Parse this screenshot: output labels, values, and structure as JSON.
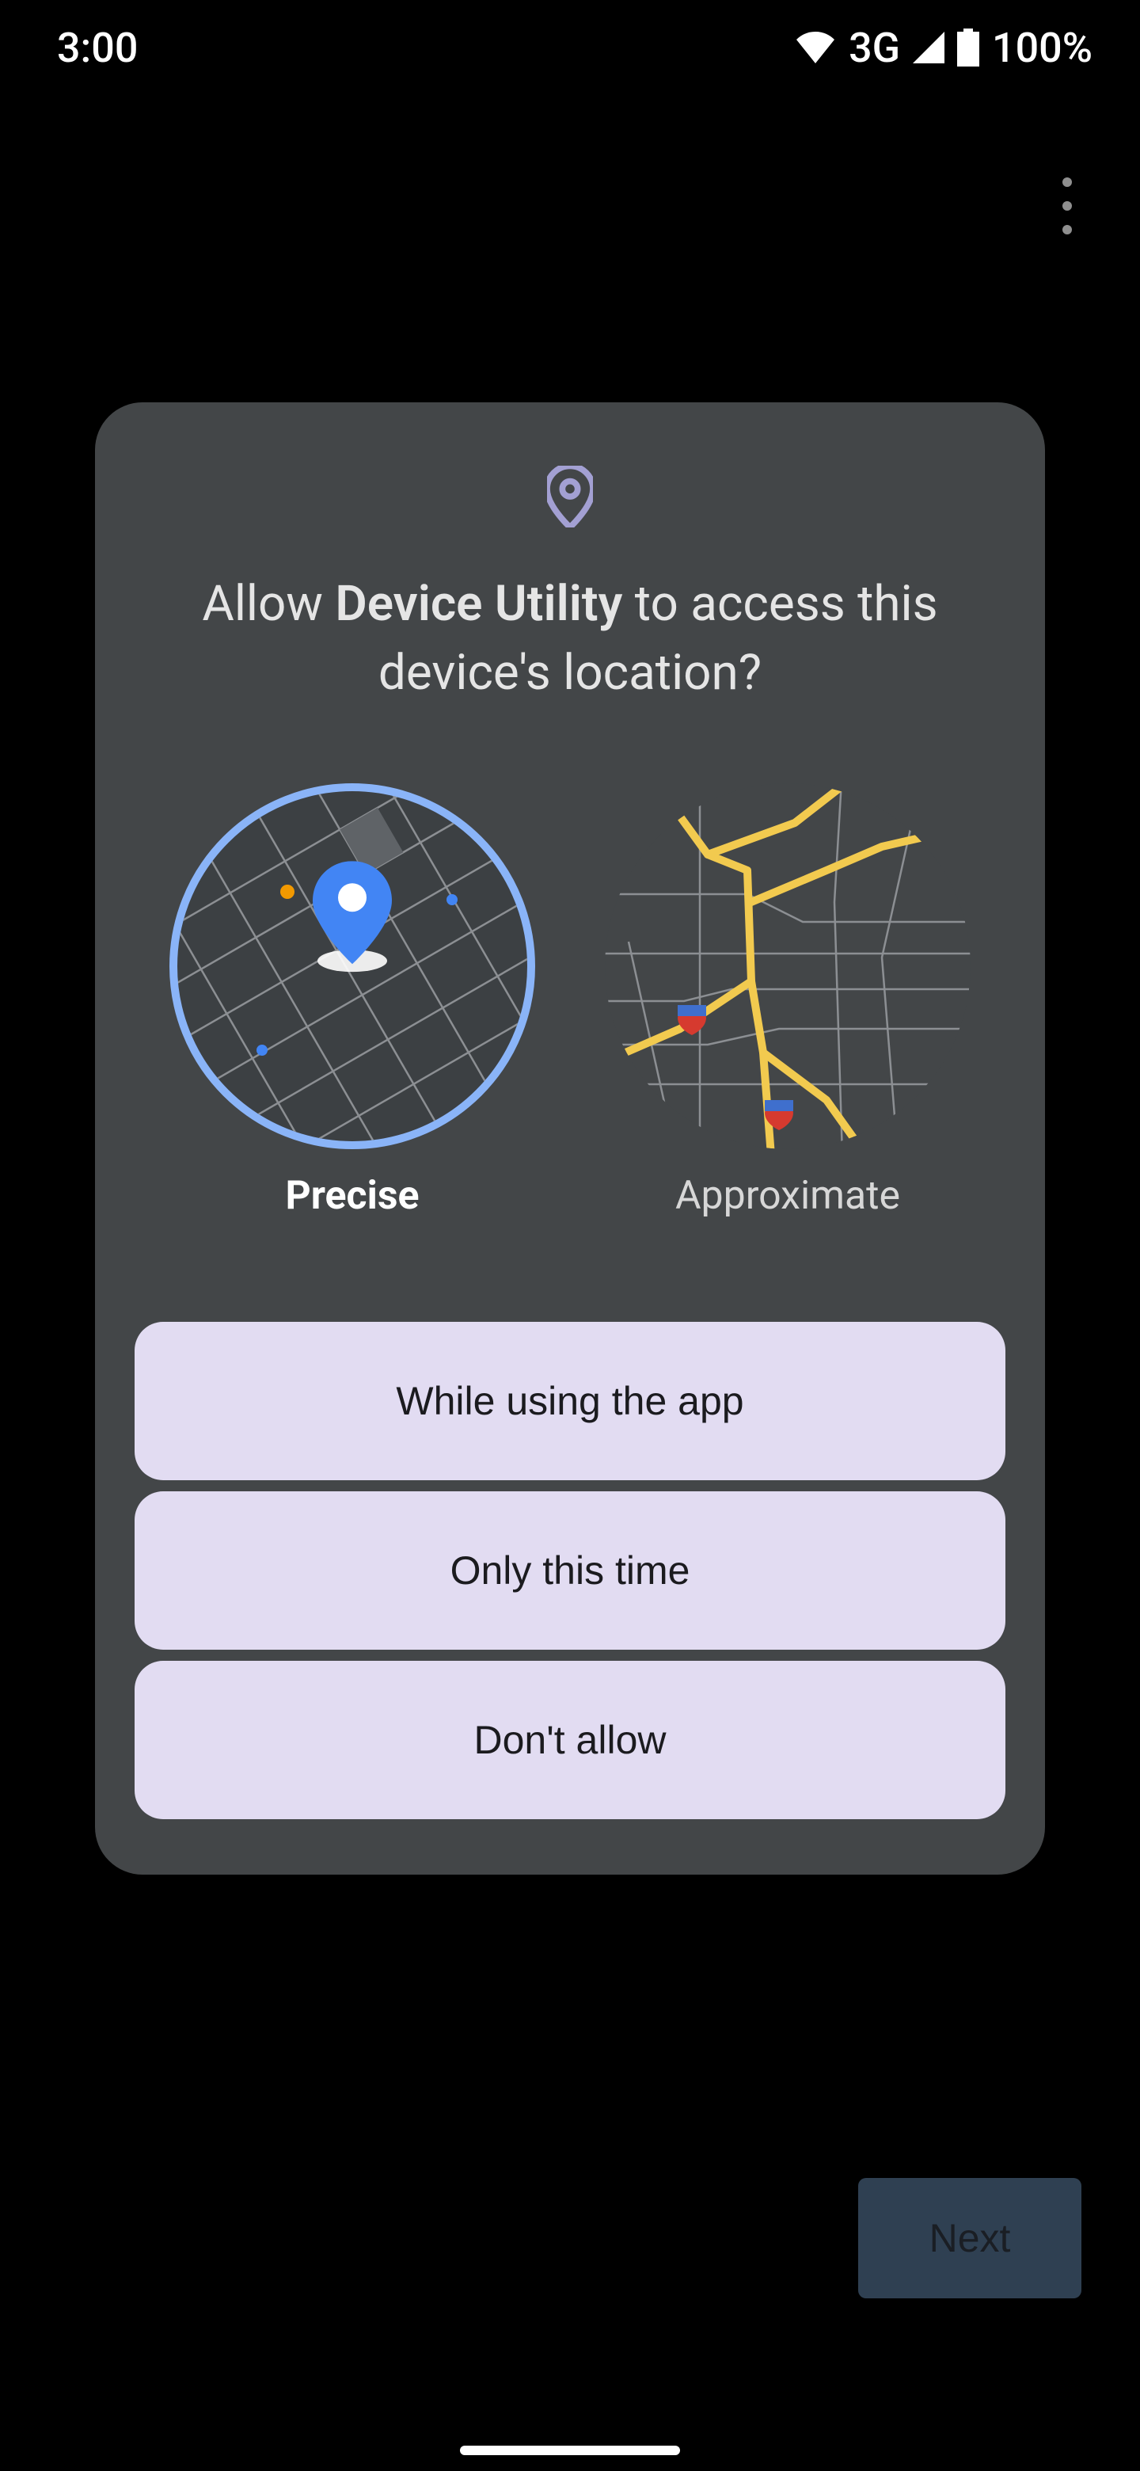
{
  "status": {
    "time": "3:00",
    "network": "3G",
    "battery": "100%"
  },
  "dialog": {
    "title_prefix": "Allow ",
    "title_app": "Device Utility",
    "title_suffix": " to access this device's location?",
    "accuracy": {
      "precise": "Precise",
      "approximate": "Approximate"
    },
    "buttons": {
      "while_using": "While using the app",
      "only_this_time": "Only this time",
      "dont_allow": "Don't allow"
    }
  },
  "next_button": "Next"
}
